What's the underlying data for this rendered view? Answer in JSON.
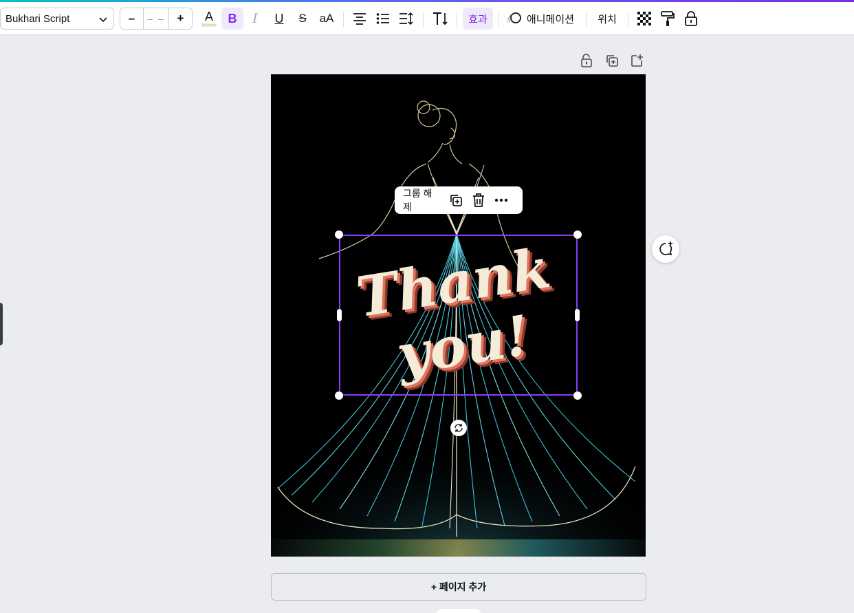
{
  "toolbar": {
    "font_name": "Bukhari Script",
    "size_decrease": "–",
    "size_value": "– –",
    "size_increase": "+",
    "bold": "B",
    "italic": "I",
    "underline": "U",
    "strike": "S",
    "case": "aA",
    "effects_label": "효과",
    "animation_label": "애니메이션",
    "position_label": "위치"
  },
  "context_menu": {
    "ungroup_label": "그룹 해제"
  },
  "design": {
    "text_line1": "Thank",
    "text_line2": "you!"
  },
  "add_page_label": "+ 페이지 추가",
  "colors": {
    "accent": "#8b3dff",
    "text_cream": "#f4ecd9",
    "shadow_coral": "#e2725b",
    "dress_teal": "#3fc2d8"
  }
}
